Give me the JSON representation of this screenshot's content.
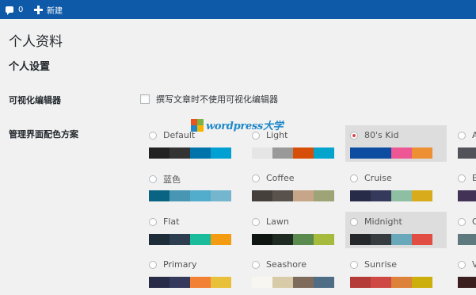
{
  "admin_bar": {
    "comment_count": "0",
    "new_label": "新建",
    "background": "#0f5aa8"
  },
  "page": {
    "title": "个人资料",
    "section_title": "个人设置"
  },
  "visual_editor": {
    "label": "可视化编辑器",
    "checkbox_label": "撰写文章时不使用可视化编辑器",
    "checked": false
  },
  "color_scheme": {
    "label": "管理界面配色方案",
    "schemes": [
      {
        "name": "Default",
        "selected": false,
        "colors": [
          "#222222",
          "#333333",
          "#0073aa",
          "#00a0d2"
        ]
      },
      {
        "name": "Light",
        "selected": false,
        "colors": [
          "#e5e5e5",
          "#999999",
          "#d64e07",
          "#04a4cc"
        ]
      },
      {
        "name": "80's Kid",
        "selected": true,
        "colors": [
          "#0c4da1",
          "#0c4da1",
          "#ed5793",
          "#ed8f33"
        ]
      },
      {
        "name": "A",
        "selected": false,
        "colors": [
          "#52525b",
          "#52525b"
        ]
      },
      {
        "name": "蓝色",
        "selected": false,
        "colors": [
          "#096484",
          "#4796b3",
          "#52accc",
          "#74b6ce"
        ]
      },
      {
        "name": "Coffee",
        "selected": false,
        "colors": [
          "#46403c",
          "#59524c",
          "#c7a589",
          "#9ea476"
        ]
      },
      {
        "name": "Cruise",
        "selected": false,
        "colors": [
          "#282b48",
          "#35395c",
          "#8fbfa3",
          "#d7ab1b"
        ]
      },
      {
        "name": "E",
        "selected": false,
        "colors": [
          "#413256",
          "#413256"
        ]
      },
      {
        "name": "Flat",
        "selected": false,
        "colors": [
          "#1f2c39",
          "#2c3e50",
          "#1abc9c",
          "#f39c12"
        ]
      },
      {
        "name": "Lawn",
        "selected": false,
        "colors": [
          "#0f1612",
          "#1f2a22",
          "#5b8a4e",
          "#a6ba3e"
        ]
      },
      {
        "name": "Midnight",
        "selected": false,
        "hovered": true,
        "colors": [
          "#25282b",
          "#363b3f",
          "#69a8bb",
          "#e14d43"
        ]
      },
      {
        "name": "O",
        "selected": false,
        "colors": [
          "#5f7a7e",
          "#5f7a7e"
        ]
      },
      {
        "name": "Primary",
        "selected": false,
        "colors": [
          "#282b48",
          "#35395c",
          "#f38135",
          "#e9c03a"
        ]
      },
      {
        "name": "Seashore",
        "selected": false,
        "colors": [
          "#f8f6f1",
          "#d8cba8",
          "#7e6b5b",
          "#4f6e85"
        ]
      },
      {
        "name": "Sunrise",
        "selected": false,
        "colors": [
          "#b43c38",
          "#cf4944",
          "#dd823b",
          "#ccaf0b"
        ]
      },
      {
        "name": "V",
        "selected": false,
        "colors": [
          "#3b1f1f",
          "#3b1f1f"
        ]
      }
    ]
  },
  "watermark": {
    "text": "wordpress大学",
    "colors": [
      "#e8541e",
      "#7cb342",
      "#1e88c9",
      "#f4b400"
    ]
  }
}
